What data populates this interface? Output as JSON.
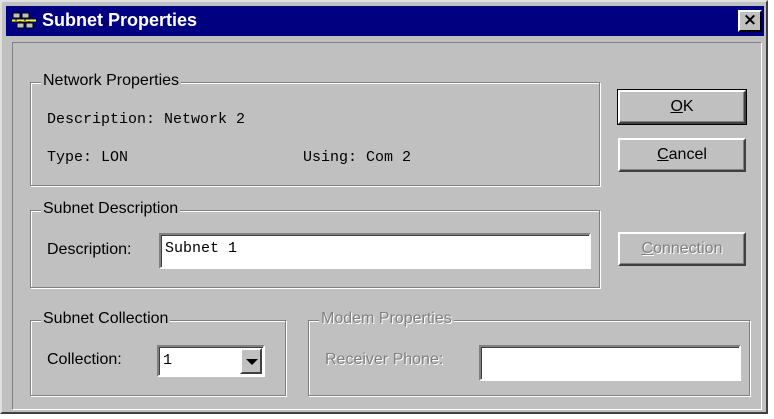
{
  "window": {
    "title": "Subnet Properties",
    "close_symbol": "×"
  },
  "network_properties": {
    "legend": "Network Properties",
    "description_text": "Description: Network 2",
    "type_text": "Type: LON",
    "using_text": "Using: Com 2"
  },
  "subnet_description": {
    "legend": "Subnet Description",
    "label": "Description:",
    "value": "Subnet 1"
  },
  "subnet_collection": {
    "legend": "Subnet Collection",
    "label": "Collection:",
    "value": "1"
  },
  "modem_properties": {
    "legend": "Modem Properties",
    "receiver_label": "Receiver Phone:",
    "receiver_value": ""
  },
  "buttons": {
    "ok": "OK",
    "cancel": "Cancel",
    "connection": "Connection"
  },
  "icons": {
    "title_icon": "network-icon",
    "close_icon": "close-icon",
    "dropdown_icon": "chevron-down-icon"
  },
  "colors": {
    "titlebar": "#000080",
    "face": "#c0c0c0",
    "disabled_text": "#808080"
  }
}
